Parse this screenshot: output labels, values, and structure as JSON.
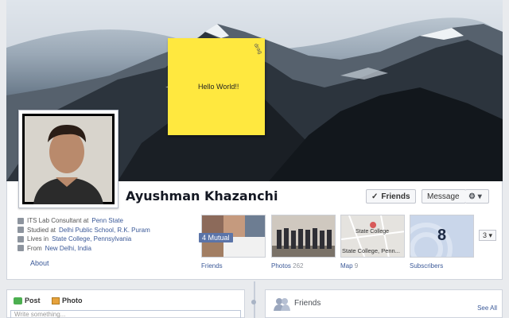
{
  "sticky_note": {
    "text": "Hello World!!",
    "handle": "drag"
  },
  "profile": {
    "name": "Ayushman Khazanchi"
  },
  "actions": {
    "friends": "Friends",
    "message": "Message",
    "gear": "⚙ ▾"
  },
  "info": [
    {
      "prefix": "ITS Lab Consultant at ",
      "link": "Penn State"
    },
    {
      "prefix": "Studied at ",
      "link": "Delhi Public School, R.K. Puram"
    },
    {
      "prefix": "Lives in ",
      "link": "State College, Pennsylvania"
    },
    {
      "prefix": "From ",
      "link": "New Delhi, India"
    }
  ],
  "about_label": "About",
  "tiles": {
    "friends": {
      "label": "Friends",
      "badge": "4 Mutual"
    },
    "photos": {
      "label": "Photos",
      "count": "262"
    },
    "map": {
      "label": "Map",
      "count": "9",
      "place": "State College",
      "footer": "State College, Penn..."
    },
    "subscribers": {
      "label": "Subscribers",
      "count": "8"
    }
  },
  "more_button": "3 ▾",
  "composer": {
    "post": "Post",
    "photo": "Photo",
    "placeholder": "Write something..."
  },
  "friends_section": {
    "title": "Friends",
    "see_all": "See All"
  }
}
